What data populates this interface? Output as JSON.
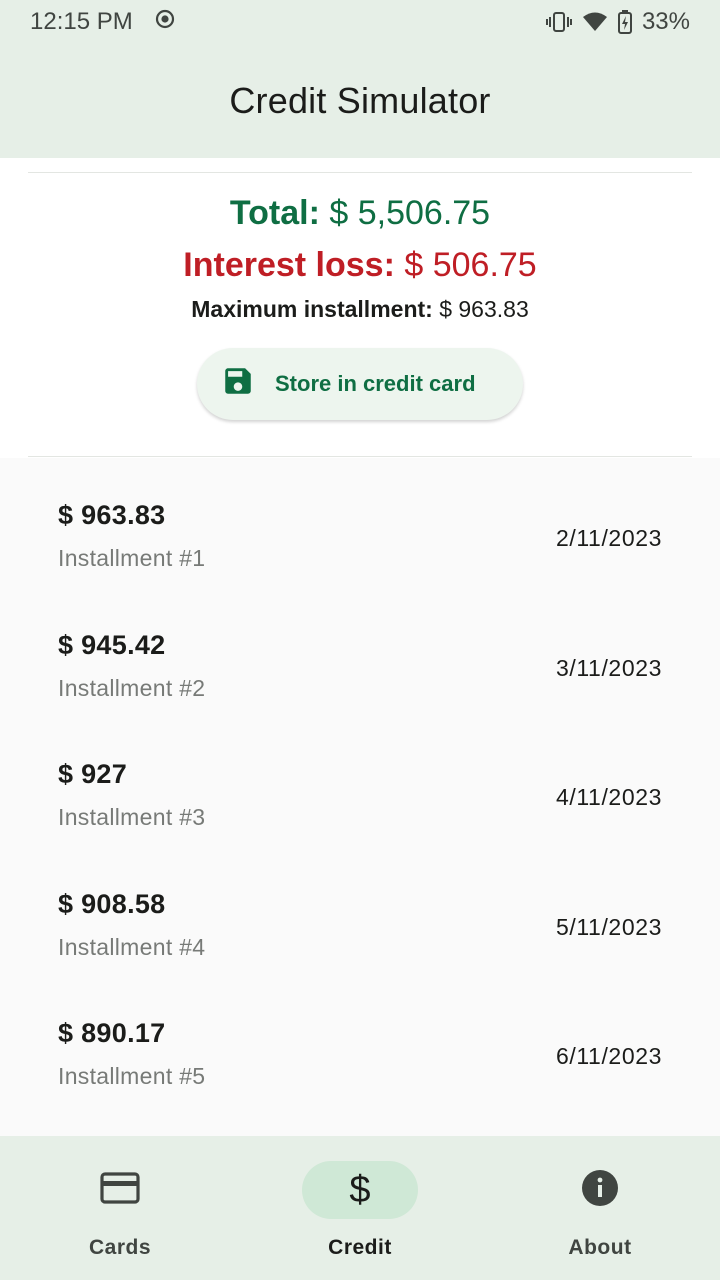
{
  "status": {
    "time": "12:15 PM",
    "battery": "33%"
  },
  "app": {
    "title": "Credit Simulator"
  },
  "summary": {
    "total_label": "Total:",
    "total_value": "$ 5,506.75",
    "interest_label": "Interest loss:",
    "interest_value": "$ 506.75",
    "max_label": "Maximum installment:",
    "max_value": "$ 963.83",
    "store_button": "Store in credit card"
  },
  "installments": [
    {
      "amount": "$ 963.83",
      "label": "Installment #1",
      "date": "2/11/2023"
    },
    {
      "amount": "$ 945.42",
      "label": "Installment #2",
      "date": "3/11/2023"
    },
    {
      "amount": "$ 927",
      "label": "Installment #3",
      "date": "4/11/2023"
    },
    {
      "amount": "$ 908.58",
      "label": "Installment #4",
      "date": "5/11/2023"
    },
    {
      "amount": "$ 890.17",
      "label": "Installment #5",
      "date": "6/11/2023"
    }
  ],
  "nav": {
    "items": [
      {
        "label": "Cards",
        "icon": "credit-card-icon"
      },
      {
        "label": "Credit",
        "icon": "dollar-icon",
        "active": true
      },
      {
        "label": "About",
        "icon": "info-icon"
      }
    ]
  },
  "colors": {
    "accent_green": "#0f6e43",
    "loss_red": "#bf1e25",
    "app_bar_bg": "#e6efe7",
    "nav_active_pill": "#cfe8d6"
  }
}
